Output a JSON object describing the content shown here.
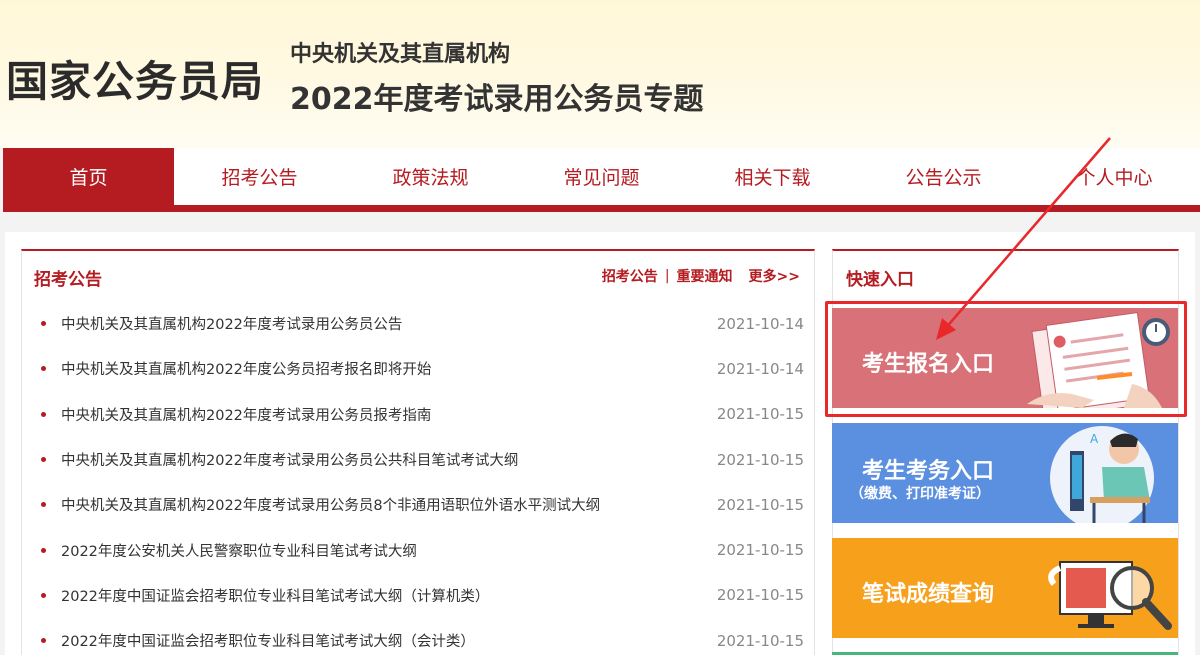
{
  "header": {
    "logo": "国家公务员局",
    "subtitle1": "中央机关及其直属机构",
    "subtitle2": "2022年度考试录用公务员专题"
  },
  "nav": {
    "items": [
      {
        "label": "首页",
        "active": true
      },
      {
        "label": "招考公告"
      },
      {
        "label": "政策法规"
      },
      {
        "label": "常见问题"
      },
      {
        "label": "相关下载"
      },
      {
        "label": "公告公示"
      },
      {
        "label": "个人中心"
      }
    ]
  },
  "announcements": {
    "title": "招考公告",
    "link1": "招考公告",
    "separator": "|",
    "link2": "重要通知",
    "more": "更多>>",
    "items": [
      {
        "title": "中央机关及其直属机构2022年度考试录用公务员公告",
        "date": "2021-10-14"
      },
      {
        "title": "中央机关及其直属机构2022年度公务员招考报名即将开始",
        "date": "2021-10-14"
      },
      {
        "title": "中央机关及其直属机构2022年度考试录用公务员报考指南",
        "date": "2021-10-15"
      },
      {
        "title": "中央机关及其直属机构2022年度考试录用公务员公共科目笔试考试大纲",
        "date": "2021-10-15"
      },
      {
        "title": "中央机关及其直属机构2022年度考试录用公务员8个非通用语职位外语水平测试大纲",
        "date": "2021-10-15"
      },
      {
        "title": "2022年度公安机关人民警察职位专业科目笔试考试大纲",
        "date": "2021-10-15"
      },
      {
        "title": "2022年度中国证监会招考职位专业科目笔试考试大纲（计算机类）",
        "date": "2021-10-15"
      },
      {
        "title": "2022年度中国证监会招考职位专业科目笔试考试大纲（会计类）",
        "date": "2021-10-15"
      }
    ]
  },
  "quick": {
    "title": "快速入口",
    "card1": "考生报名入口",
    "card2": "考生考务入口",
    "card2_sub": "（缴费、打印准考证）",
    "card3": "笔试成绩查询"
  },
  "colors": {
    "brand_red": "#b51c21",
    "card1": "#d97278",
    "card2": "#5b8fe0",
    "card3": "#f7a01c",
    "highlight": "#e8282a"
  }
}
